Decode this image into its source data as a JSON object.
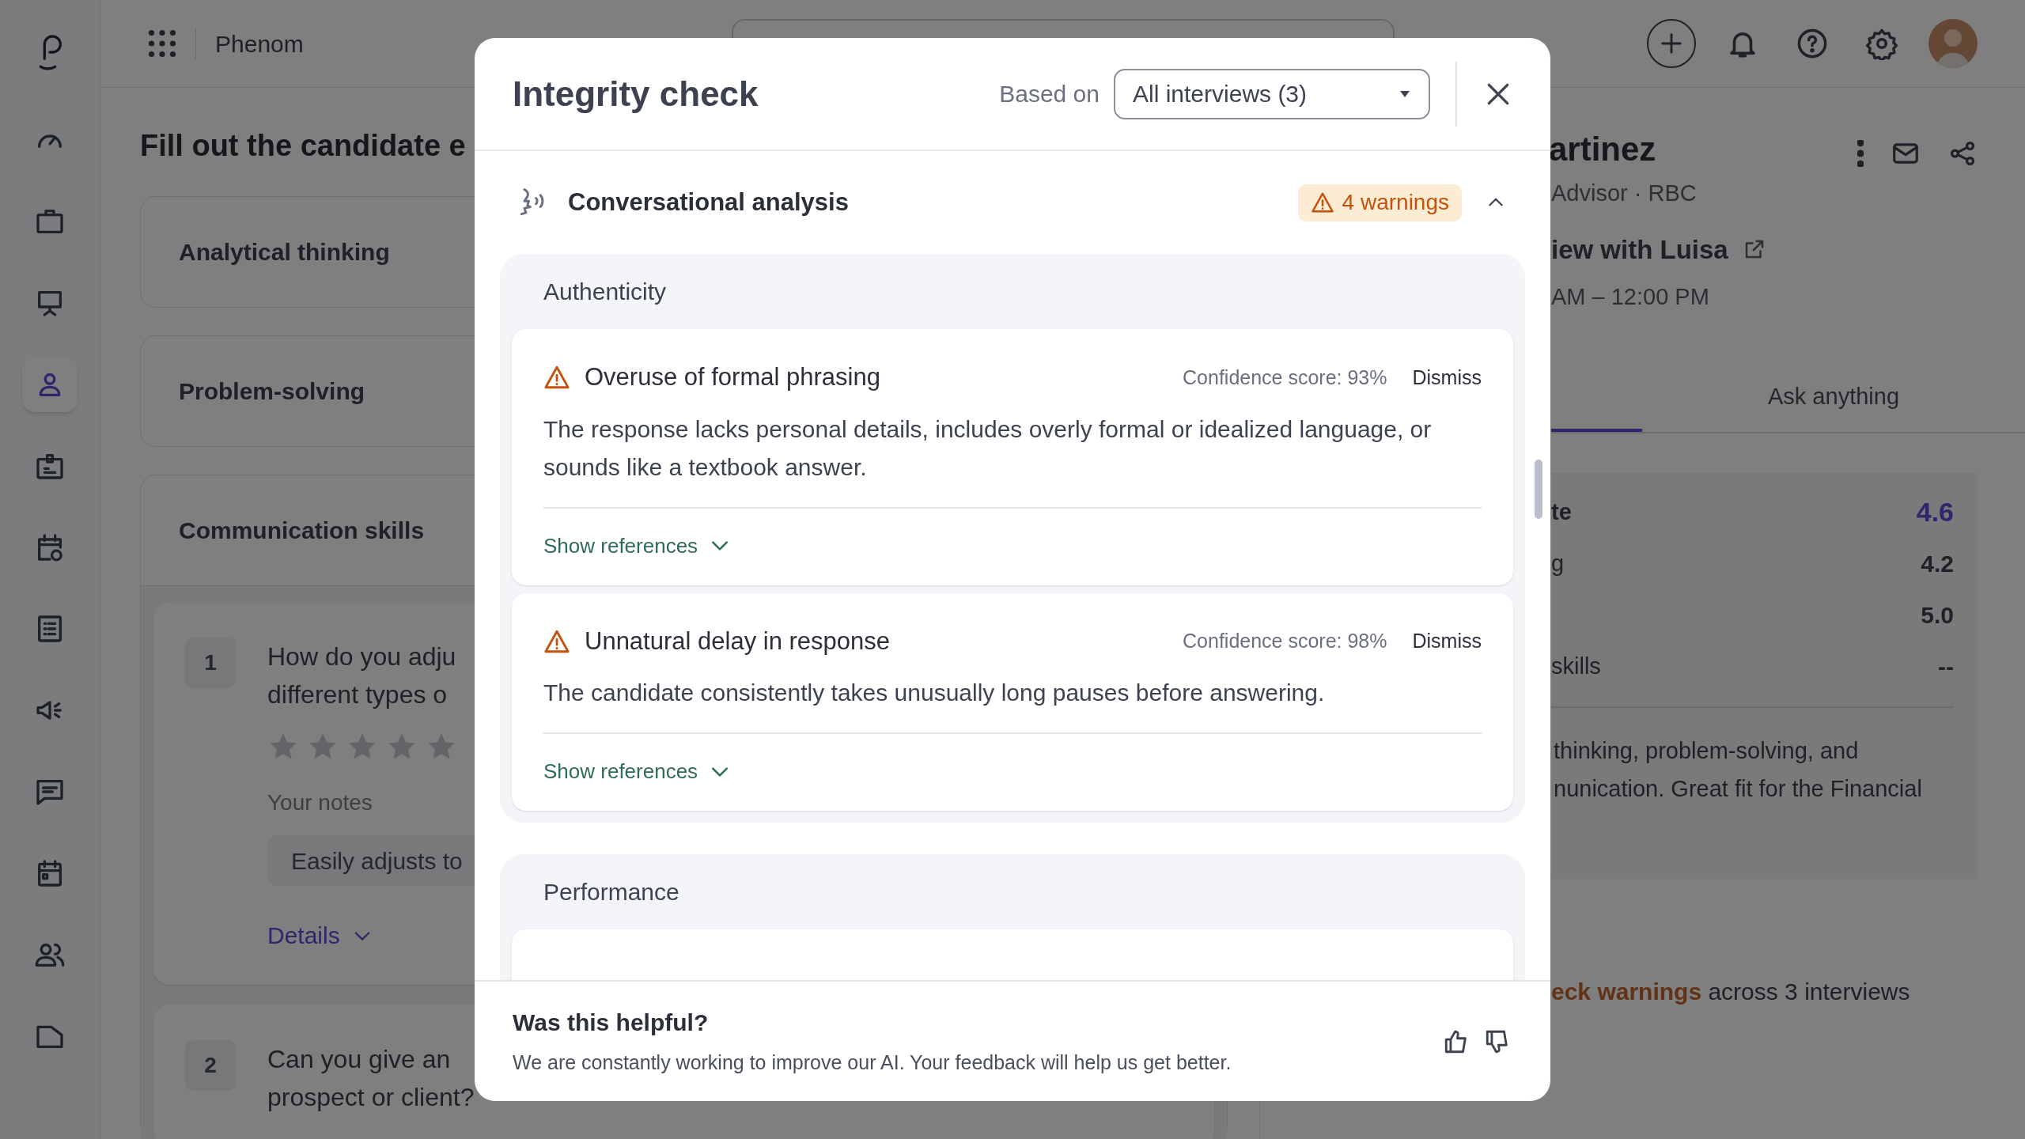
{
  "topbar": {
    "brand": "Phenom"
  },
  "sidebar": {
    "items": [
      {
        "selected": false
      },
      {
        "selected": false
      },
      {
        "selected": false
      },
      {
        "selected": true
      },
      {
        "selected": false
      },
      {
        "selected": false
      },
      {
        "selected": false
      },
      {
        "selected": false
      },
      {
        "selected": false
      },
      {
        "selected": false
      },
      {
        "selected": false
      },
      {
        "selected": false
      }
    ]
  },
  "page": {
    "title": "Fill out the candidate e",
    "competencies": [
      "Analytical thinking",
      "Problem-solving",
      "Communication skills"
    ],
    "questions": [
      {
        "number": "1",
        "lines": [
          "How do you adju",
          "different types o"
        ],
        "stars": 0,
        "notes_label": "Your notes",
        "notes_value": "Easily adjusts to",
        "details_link": "Details"
      },
      {
        "number": "2",
        "lines": [
          "Can you give an",
          "prospect or client?"
        ]
      }
    ]
  },
  "candidate_panel": {
    "name": "artinez",
    "subtitle": "Advisor · RBC",
    "interview_link": "iew with Luisa",
    "time": "AM – 12:00 PM",
    "tabs": [
      {
        "selected": true
      },
      {
        "label": "Ask anything",
        "selected": false
      }
    ],
    "scores": [
      {
        "label": "te",
        "value": "4.6",
        "kind": "overall"
      },
      {
        "label": "g",
        "value": "4.2",
        "kind": "item"
      },
      {
        "value": "5.0",
        "kind": "item"
      },
      {
        "label": "skills",
        "value": "--",
        "kind": "item"
      }
    ],
    "summary_lines": [
      "thinking, problem-solving, and",
      "nunication. Great fit for the Financial"
    ],
    "warnings_line": "**eck warnings** across 3 interviews"
  },
  "modal": {
    "title": "Integrity check",
    "based_on_label": "Based on",
    "based_on_value": "All interviews (3)",
    "section": {
      "title": "Conversational analysis",
      "badge": "4 warnings",
      "expanded": true
    },
    "groups": [
      {
        "title": "Authenticity",
        "findings": [
          {
            "title": "Overuse of formal phrasing",
            "confidence": "Confidence score: 93%",
            "dismiss": "Dismiss",
            "description": "The response lacks personal details, includes overly formal or idealized language, or sounds like a textbook answer.",
            "references_link": "Show references"
          },
          {
            "title": "Unnatural delay in response",
            "confidence": "Confidence score: 98%",
            "dismiss": "Dismiss",
            "description": "The candidate consistently takes unusually long pauses before answering.",
            "references_link": "Show references"
          }
        ]
      },
      {
        "title": "Performance"
      }
    ],
    "feedback": {
      "title": "Was this helpful?",
      "text": "We are constantly working to improve our AI. Your feedback will help us get better."
    }
  }
}
